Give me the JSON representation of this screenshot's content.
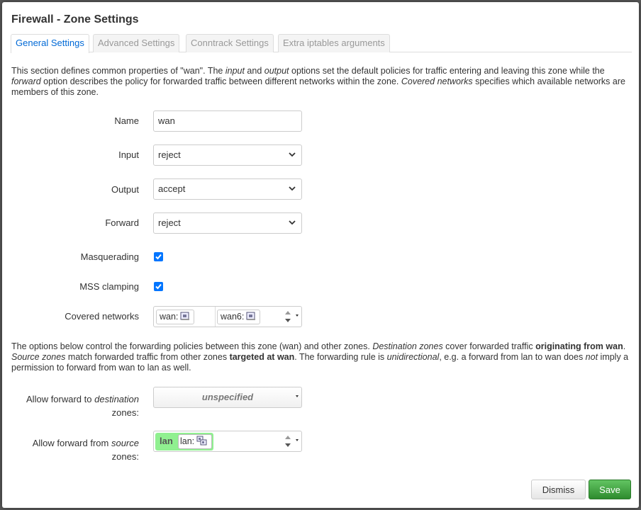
{
  "dialog": {
    "title": "Firewall - Zone Settings"
  },
  "tabs": [
    {
      "label": "General Settings",
      "active": true
    },
    {
      "label": "Advanced Settings",
      "active": false
    },
    {
      "label": "Conntrack Settings",
      "active": false
    },
    {
      "label": "Extra iptables arguments",
      "active": false
    }
  ],
  "description1": {
    "p1": "This section defines common properties of \"wan\". The ",
    "i1": "input",
    "p2": " and ",
    "i2": "output",
    "p3": " options set the default policies for traffic entering and leaving this zone while the ",
    "i3": "forward",
    "p4": " option describes the policy for forwarded traffic between different networks within the zone. ",
    "i4": "Covered networks",
    "p5": " specifies which available networks are members of this zone."
  },
  "form": {
    "name_label": "Name",
    "name_value": "wan",
    "input_label": "Input",
    "input_value": "reject",
    "output_label": "Output",
    "output_value": "accept",
    "forward_label": "Forward",
    "forward_value": "reject",
    "masquerading_label": "Masquerading",
    "masquerading_checked": true,
    "mss_label": "MSS clamping",
    "mss_checked": true,
    "covered_label": "Covered networks",
    "covered_networks": [
      "wan:",
      "wan6:"
    ]
  },
  "description2": {
    "p1": "The options below control the forwarding policies between this zone (wan) and other zones. ",
    "i1": "Destination zones",
    "p2": " cover forwarded traffic ",
    "b1": "originating from wan",
    "p3": ". ",
    "i2": "Source zones",
    "p4": " match forwarded traffic from other zones ",
    "b2": "targeted at wan",
    "p5": ". The forwarding rule is ",
    "i3": "unidirectional",
    "p6": ", e.g. a forward from lan to wan does ",
    "i4": "not",
    "p7": " imply a permission to forward from wan to lan as well."
  },
  "forwarding": {
    "dest_label_a": "Allow forward to ",
    "dest_label_i": "destination",
    "dest_label_b": "zones",
    "dest_label_c": ":",
    "dest_value": "unspecified",
    "src_label_a": "Allow forward from ",
    "src_label_i": "source",
    "src_label_b": "zones",
    "src_label_c": ":",
    "src_zone_name": "lan",
    "src_zone_net": "lan:",
    "src_zone_color": "#90f090"
  },
  "buttons": {
    "dismiss": "Dismiss",
    "save": "Save"
  },
  "colors": {
    "accent": "#0069d6",
    "save": "#2e8b2e",
    "checkbox": "#0075ff"
  }
}
